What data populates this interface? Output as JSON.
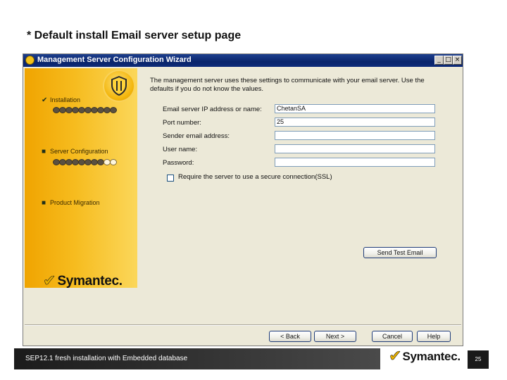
{
  "slide": {
    "title": "* Default install Email server setup  page",
    "footer_text": "SEP12.1 fresh installation with Embedded database",
    "page_number": "25",
    "footer_logo": "Symantec."
  },
  "window": {
    "title": "Management Server Configuration Wizard",
    "minimize_label": "_",
    "maximize_label": "□",
    "close_label": "×"
  },
  "steps": [
    {
      "label": "Installation",
      "state": "completed",
      "progress": {
        "filled": 10,
        "total": 10
      }
    },
    {
      "label": "Server Configuration",
      "state": "current",
      "progress": {
        "filled": 8,
        "total": 10
      }
    },
    {
      "label": "Product Migration",
      "state": "pending"
    }
  ],
  "brand_name": "Symantec.",
  "form": {
    "intro": "The management server uses these settings to communicate with your email server.  Use the defaults if you do not know the values.",
    "fields": [
      {
        "label": "Email server IP address or name:",
        "value": "ChetanSA"
      },
      {
        "label": "Port number:",
        "value": "25"
      },
      {
        "label": "Sender email address:",
        "value": ""
      },
      {
        "label": "User name:",
        "value": ""
      },
      {
        "label": "Password:",
        "value": ""
      }
    ],
    "ssl_checkbox": {
      "label": "Require the server to use a secure connection(SSL)",
      "checked": false
    },
    "send_test_label": "Send Test Email"
  },
  "buttons": {
    "back": "< Back",
    "next": "Next >",
    "cancel": "Cancel",
    "help": "Help"
  },
  "colors": {
    "titlebar": "#0a246a",
    "panel_gold": "#f6bc1f",
    "window_bg": "#ece9d8",
    "footer": "#1b1b1b"
  }
}
